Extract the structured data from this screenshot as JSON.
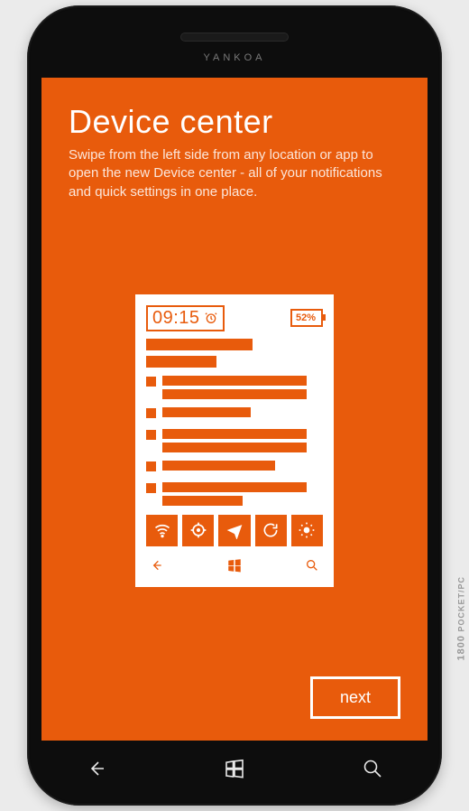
{
  "device": {
    "brand": "YANKOA"
  },
  "page": {
    "title": "Device center",
    "subtitle": "Swipe from the left side from any location or app to open the new Device center - all of your notifications and quick settings in one place."
  },
  "mock": {
    "time": "09:15",
    "battery": "52%"
  },
  "actions": {
    "next_label": "next"
  },
  "watermark": {
    "line1": "1800",
    "line2": "POCKET/PC"
  }
}
